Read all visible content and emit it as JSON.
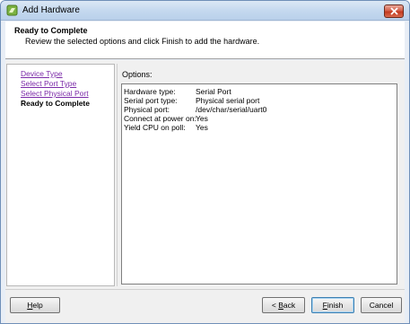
{
  "window": {
    "title": "Add Hardware"
  },
  "header": {
    "title": "Ready to Complete",
    "subtitle": "Review the selected options and click Finish to add the hardware."
  },
  "nav": {
    "items": [
      {
        "label": "Device Type",
        "state": "link"
      },
      {
        "label": "Select Port Type",
        "state": "link"
      },
      {
        "label": "Select Physical Port",
        "state": "link"
      },
      {
        "label": "Ready to Complete",
        "state": "current"
      }
    ]
  },
  "options": {
    "label": "Options:",
    "rows": [
      {
        "key": "Hardware type:",
        "value": "Serial Port"
      },
      {
        "key": "Serial port type:",
        "value": "Physical serial port"
      },
      {
        "key": "Physical port:",
        "value": "/dev/char/serial/uart0"
      },
      {
        "key": "Connect at power on:",
        "value": "Yes"
      },
      {
        "key": "Yield CPU on poll:",
        "value": "Yes"
      }
    ]
  },
  "footer": {
    "help": {
      "mnemonic": "H",
      "rest": "elp"
    },
    "back": {
      "prefix": "< ",
      "mnemonic": "B",
      "rest": "ack"
    },
    "finish": {
      "mnemonic": "F",
      "rest": "inish"
    },
    "cancel": "Cancel"
  },
  "colors": {
    "link": "#7b2aa8",
    "title_bar": "#c5d9ef",
    "close_button": "#c2391f"
  }
}
